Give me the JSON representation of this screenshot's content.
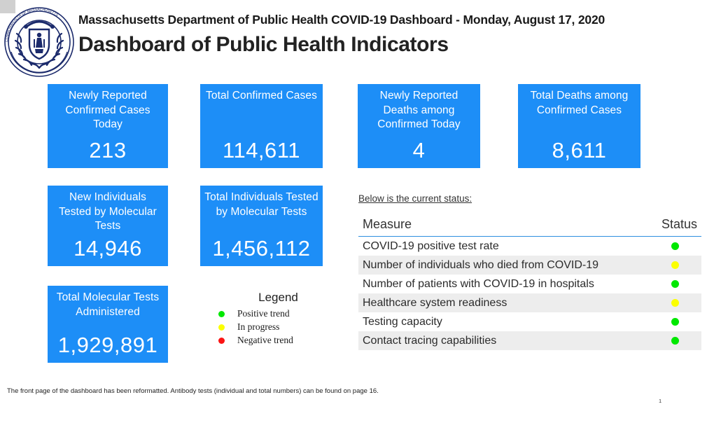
{
  "header": {
    "line1": "Massachusetts Department of Public Health COVID-19 Dashboard -  Monday, August 17, 2020",
    "line2": "Dashboard of Public Health Indicators",
    "seal_icon": "ma-dph-seal-icon"
  },
  "colors": {
    "tile_blue": "#1d8ef7",
    "rule_blue": "#2d8fe0",
    "green": "#00e800",
    "yellow": "#fbff00",
    "red": "#fb1414",
    "row_stripe": "#ededed"
  },
  "tiles": [
    {
      "label": "Newly Reported Confirmed Cases Today",
      "value": "213"
    },
    {
      "label": "Total Confirmed Cases",
      "value": "114,611"
    },
    {
      "label": "Newly Reported Deaths among Confirmed Today",
      "value": "4"
    },
    {
      "label": "Total Deaths among Confirmed Cases",
      "value": "8,611"
    },
    {
      "label": "New Individuals Tested by Molecular Tests",
      "value": "14,946"
    },
    {
      "label": "Total Individuals Tested by Molecular Tests",
      "value": "1,456,112"
    },
    {
      "label": "Total Molecular Tests Administered",
      "value": "1,929,891"
    }
  ],
  "legend": {
    "title": "Legend",
    "items": [
      {
        "label": "Positive trend",
        "color": "#00e800"
      },
      {
        "label": "In progress",
        "color": "#fbff00"
      },
      {
        "label": "Negative trend",
        "color": "#fb1414"
      }
    ]
  },
  "status": {
    "note": "Below is the current status:",
    "col_measure": "Measure",
    "col_status": "Status",
    "rows": [
      {
        "measure": "COVID-19 positive test rate",
        "status": "#00e800"
      },
      {
        "measure": "Number of individuals who died from COVID-19",
        "status": "#fbff00"
      },
      {
        "measure": "Number of patients with COVID-19 in hospitals",
        "status": "#00e800"
      },
      {
        "measure": "Healthcare system readiness",
        "status": "#fbff00"
      },
      {
        "measure": "Testing capacity",
        "status": "#00e800"
      },
      {
        "measure": "Contact tracing capabilities",
        "status": "#00e800"
      }
    ]
  },
  "footer": {
    "note": "The front page of the dashboard has been reformatted. Antibody tests (individual and total numbers) can be found on page 16.",
    "page_number": "1"
  }
}
